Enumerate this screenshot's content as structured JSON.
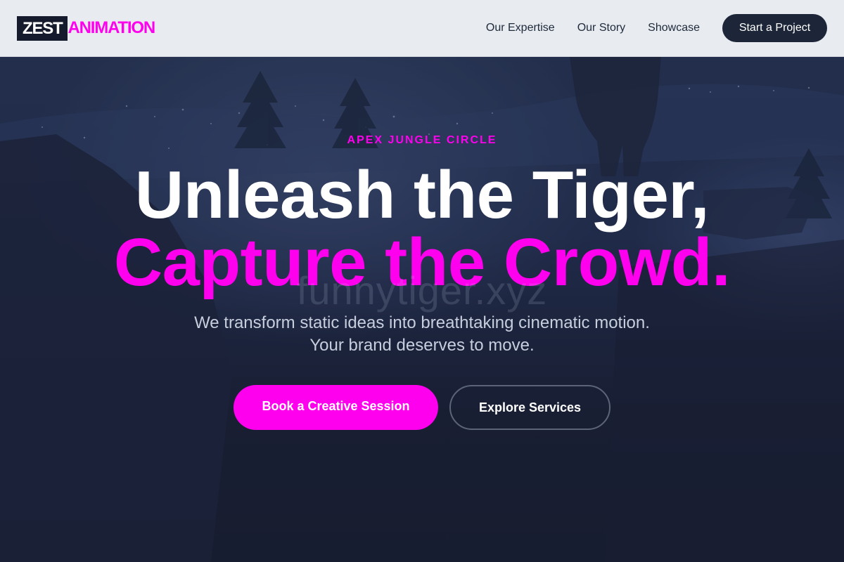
{
  "header": {
    "logo_main": "ZEST",
    "logo_accent": "ANIMATION",
    "nav": [
      "Our Expertise",
      "Our Story",
      "Showcase"
    ],
    "cta": "Start a Project"
  },
  "hero": {
    "eyebrow": "APEX JUNGLE CIRCLE",
    "headline_line1": "Unleash the Tiger,",
    "headline_line2": "Capture the Crowd.",
    "watermark": "funnytiger.xyz",
    "subtext_line1": "We transform static ideas into breathtaking cinematic motion.",
    "subtext_line2": "Your brand deserves to move.",
    "primary_button": "Book a Creative Session",
    "secondary_button": "Explore Services"
  },
  "colors": {
    "accent": "#ff00ee",
    "header_bg": "#e8ebef",
    "dark": "#1c2638",
    "hero_overlay": "#1b2034"
  }
}
